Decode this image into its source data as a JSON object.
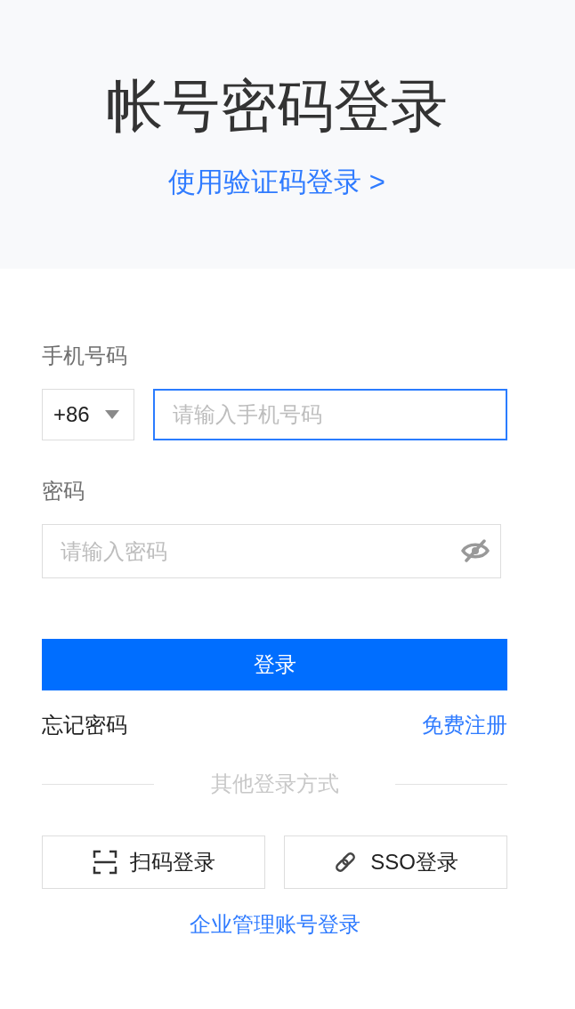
{
  "header": {
    "title": "帐号密码登录",
    "switch_link": "使用验证码登录 >"
  },
  "fields": [
    {
      "kind": "phone",
      "label": "手机号码",
      "country_code": "+86",
      "placeholder": "请输入手机号码",
      "focused": true
    },
    {
      "kind": "password",
      "label": "密码",
      "placeholder": "请输入密码",
      "focused": false,
      "password_visible": false
    }
  ],
  "login_button": "登录",
  "links": {
    "forgot": "忘记密码",
    "register": "免费注册"
  },
  "other_login": {
    "divider": "其他登录方式",
    "buttons": [
      {
        "kind": "scan",
        "label": "扫码登录"
      },
      {
        "kind": "sso",
        "label": "SSO登录"
      }
    ]
  },
  "enterprise_link": "企业管理账号登录"
}
